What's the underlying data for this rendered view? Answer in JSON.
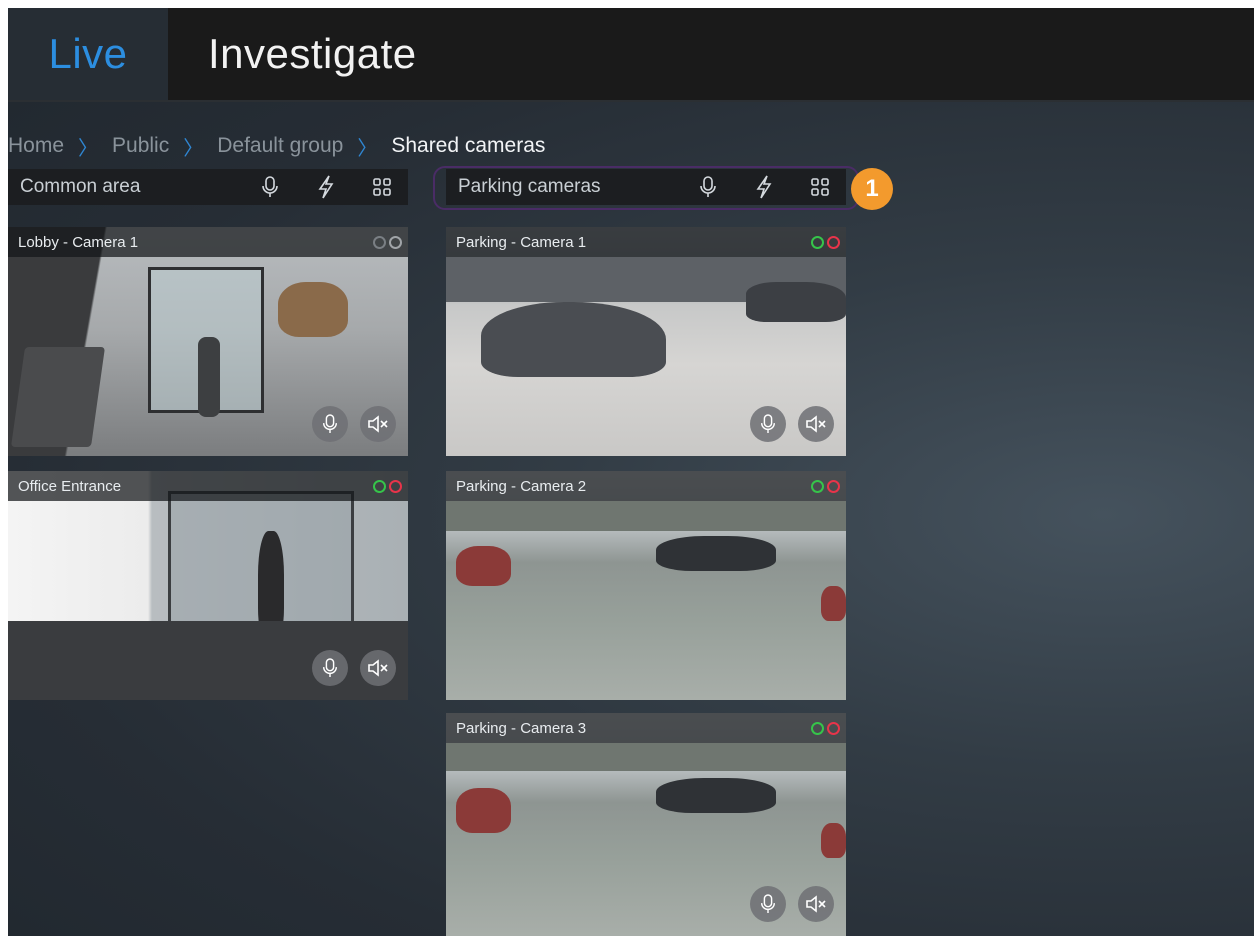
{
  "tabs": [
    {
      "label": "Live",
      "active": true
    },
    {
      "label": "Investigate",
      "active": false
    }
  ],
  "breadcrumb": [
    "Home",
    "Public",
    "Default group",
    "Shared cameras"
  ],
  "groups": [
    {
      "title": "Common area"
    },
    {
      "title": "Parking cameras"
    }
  ],
  "callout": {
    "label": "1"
  },
  "cameras": [
    {
      "title": "Lobby - Camera 1",
      "status": "inactive"
    },
    {
      "title": "Office Entrance",
      "status": "active"
    },
    {
      "title": "Parking - Camera 1",
      "status": "active"
    },
    {
      "title": "Parking - Camera 2",
      "status": "active"
    },
    {
      "title": "Parking - Camera 3",
      "status": "active"
    }
  ],
  "icons": {
    "microphone": "microphone-icon",
    "lightning": "lightning-icon",
    "grid": "grid-layout-icon",
    "mute": "speaker-muted-icon"
  },
  "colors": {
    "accent": "#2c8ee0",
    "callout": "#f39a2d",
    "status_green": "#36c44a",
    "status_red": "#e8344a",
    "highlight": "#4a2c66"
  }
}
